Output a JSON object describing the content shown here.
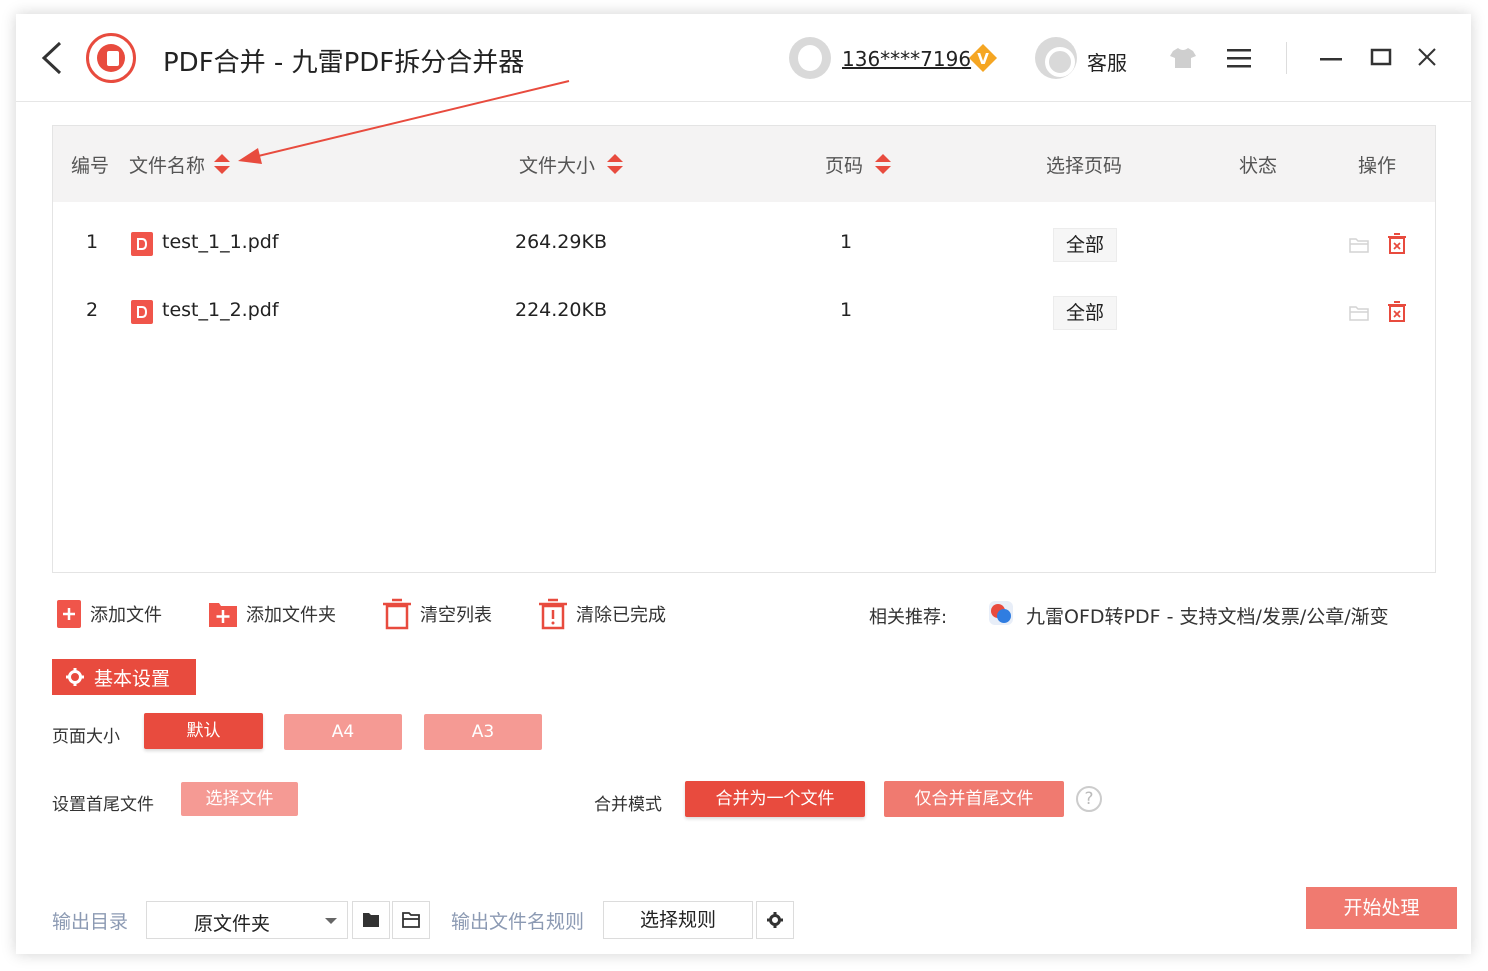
{
  "titlebar": {
    "title": "PDF合并 - 九雷PDF拆分合并器",
    "user_phone": "136****7196",
    "vip_badge": "V",
    "service_label": "客服"
  },
  "table": {
    "headers": {
      "index": "编号",
      "name": "文件名称",
      "size": "文件大小",
      "pages": "页码",
      "select_pages": "选择页码",
      "status": "状态",
      "actions": "操作"
    },
    "rows": [
      {
        "index": "1",
        "name": "test_1_1.pdf",
        "size": "264.29KB",
        "pages": "1",
        "select": "全部",
        "status": ""
      },
      {
        "index": "2",
        "name": "test_1_2.pdf",
        "size": "224.20KB",
        "pages": "1",
        "select": "全部",
        "status": ""
      }
    ]
  },
  "toolbar": {
    "add_file": "添加文件",
    "add_folder": "添加文件夹",
    "clear_list": "清空列表",
    "clear_done": "清除已完成",
    "related_label": "相关推荐:",
    "related_link": "九雷OFD转PDF - 支持文档/发票/公章/渐变"
  },
  "settings": {
    "tab_label": "基本设置",
    "page_size_label": "页面大小",
    "page_sizes": [
      "默认",
      "A4",
      "A3"
    ],
    "selected_page_size": "默认",
    "head_tail_label": "设置首尾文件",
    "choose_file": "选择文件",
    "merge_mode_label": "合并模式",
    "merge_modes": [
      "合并为一个文件",
      "仅合并首尾文件"
    ],
    "selected_merge_mode": "合并为一个文件",
    "help": "?"
  },
  "bottom": {
    "output_dir_label": "输出目录",
    "output_dir_value": "原文件夹",
    "output_name_label": "输出文件名规则",
    "choose_rule": "选择规则",
    "start": "开始处理"
  },
  "colors": {
    "accent": "#e84b3e",
    "accent_light": "#f59a94",
    "header_bg": "#f4f3f3",
    "muted_label": "#8c9ab3"
  }
}
